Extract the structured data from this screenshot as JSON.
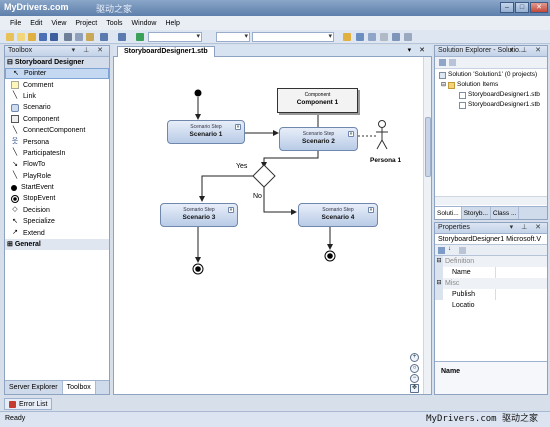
{
  "window": {
    "title": "MyDrivers.com",
    "watermark": "驱动之家"
  },
  "menu": [
    "File",
    "Edit",
    "View",
    "Project",
    "Tools",
    "Window",
    "Help"
  ],
  "toolbox": {
    "title": "Toolbox",
    "section1": "Storyboard Designer",
    "items": [
      "Pointer",
      "Comment",
      "Link",
      "Scenario",
      "Component",
      "ConnectComponent",
      "Persona",
      "ParticipatesIn",
      "FlowTo",
      "PlayRole",
      "StartEvent",
      "StopEvent",
      "Decision",
      "Specialize",
      "Extend"
    ],
    "section2": "General",
    "tabs": [
      "Server Explorer",
      "Toolbox"
    ]
  },
  "document": {
    "tab": "StoryboardDesigner1.stb",
    "diagram": {
      "component": {
        "sub": "Component",
        "main": "Component 1"
      },
      "scenario1": {
        "sub": "Scenario Step",
        "main": "Scenario 1"
      },
      "scenario2": {
        "sub": "Scenario Step",
        "main": "Scenario 2"
      },
      "scenario3": {
        "sub": "Scenario Step",
        "main": "Scenario 3"
      },
      "scenario4": {
        "sub": "Scenario Step",
        "main": "Scenario 4"
      },
      "persona": "Persona 1",
      "yes": "Yes",
      "no": "No"
    }
  },
  "solution_explorer": {
    "title": "Solution Explorer - Solutio...",
    "rows": [
      "Solution 'Solution1' (0 projects)",
      "Solution Items",
      "StoryboardDesigner1.stb",
      "StoryboardDesigner1.stb"
    ],
    "tabs": [
      "Soluti...",
      "Storyb...",
      "Class ..."
    ]
  },
  "properties": {
    "title": "Properties",
    "object": "StoryboardDesigner1  Microsoft.V",
    "cat_definition": "Definition",
    "name_key": "Name",
    "cat_misc": "Misc",
    "publish_key": "Publish Locatio",
    "desc_title": "Name"
  },
  "error_list": "Error List",
  "status": {
    "text": "Ready",
    "watermark": "MyDrivers.com 驱动之家"
  }
}
